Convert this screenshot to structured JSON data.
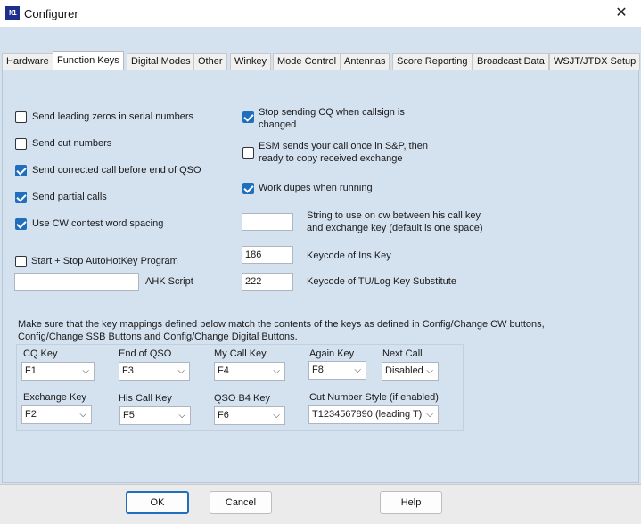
{
  "window": {
    "title": "Configurer",
    "icon": "n1mm-logo-icon"
  },
  "tabs": [
    {
      "label": "Hardware"
    },
    {
      "label": "Function Keys",
      "active": true
    },
    {
      "label": "Digital Modes"
    },
    {
      "label": "Other"
    },
    {
      "label": "Winkey"
    },
    {
      "label": "Mode Control"
    },
    {
      "label": "Antennas"
    },
    {
      "label": "Score Reporting"
    },
    {
      "label": "Broadcast Data"
    },
    {
      "label": "WSJT/JTDX Setup"
    }
  ],
  "left_options": [
    {
      "label": "Send leading zeros in serial numbers",
      "checked": false
    },
    {
      "label": "Send cut numbers",
      "checked": false
    },
    {
      "label": "Send corrected call before end of QSO",
      "checked": true
    },
    {
      "label": "Send partial calls",
      "checked": true
    },
    {
      "label": "Use CW contest word spacing",
      "checked": true
    }
  ],
  "autohotkey": {
    "label": "Start + Stop AutoHotKey Program",
    "checked": false,
    "script_label": "AHK Script",
    "script_value": ""
  },
  "right_options": [
    {
      "line1": "Stop sending CQ when callsign is",
      "line2": "changed",
      "checked": true
    },
    {
      "line1": "ESM sends your call once in S&P, then",
      "line2": "ready to copy received exchange",
      "checked": false
    },
    {
      "line1": "Work dupes when running",
      "line2": "",
      "checked": true
    }
  ],
  "fields": {
    "cw_string": {
      "value": "",
      "line1": "String to use on cw between his call key",
      "line2": "and exchange key (default is one space)"
    },
    "ins_key": {
      "value": "186",
      "label": "Keycode of Ins Key"
    },
    "tu_key": {
      "value": "222",
      "label": "Keycode of TU/Log Key Substitute"
    }
  },
  "note": {
    "line1": "Make sure that the key mappings defined below match the contents of the keys as defined in Config/Change CW buttons,",
    "line2": "Config/Change SSB Buttons and Config/Change Digital Buttons."
  },
  "keys": {
    "cq": {
      "label": "CQ Key",
      "value": "F1"
    },
    "end_qso": {
      "label": "End of QSO",
      "value": "F3"
    },
    "my_call": {
      "label": "My Call Key",
      "value": "F4"
    },
    "again": {
      "label": "Again  Key",
      "value": "F8"
    },
    "next_call": {
      "label": "Next Call",
      "value": "Disabled"
    },
    "exchange": {
      "label": "Exchange  Key",
      "value": "F2"
    },
    "his_call": {
      "label": "His Call Key",
      "value": "F5"
    },
    "qso_b4": {
      "label": "QSO B4 Key",
      "value": "F6"
    },
    "cut_style": {
      "label": "Cut Number Style (if enabled)",
      "value": "T1234567890 (leading T)"
    }
  },
  "buttons": {
    "ok": "OK",
    "cancel": "Cancel",
    "help": "Help"
  },
  "glyphs": {
    "close": "✕",
    "chevron": "⌵"
  },
  "colors": {
    "accent": "#1f6fbe",
    "panel": "#d4e1ef"
  }
}
